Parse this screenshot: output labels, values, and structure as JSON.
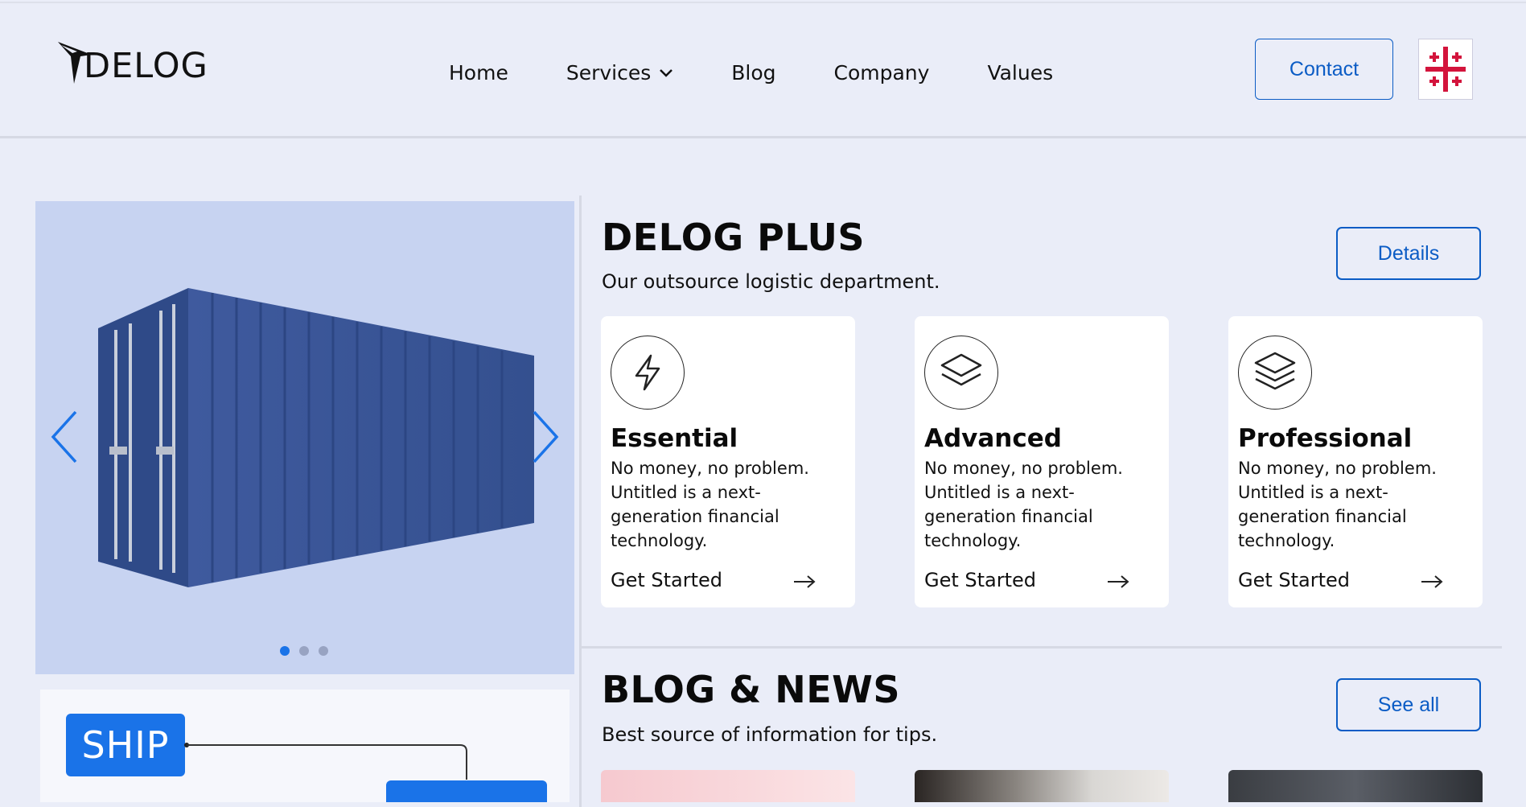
{
  "header": {
    "logo_text": "DELOG",
    "nav": [
      {
        "label": "Home"
      },
      {
        "label": "Services"
      },
      {
        "label": "Blog"
      },
      {
        "label": "Company"
      },
      {
        "label": "Values"
      }
    ],
    "contact_label": "Contact",
    "language_flag": "georgia-flag-icon"
  },
  "hero": {
    "slides_count": 3,
    "active_slide": 1,
    "prev_icon": "chevron-left-icon",
    "next_icon": "chevron-right-icon",
    "diagram_label": "SHIP"
  },
  "plus": {
    "title": "DELOG PLUS",
    "subtitle": "Our outsource logistic department.",
    "details_label": "Details",
    "cards": [
      {
        "icon": "lightning-icon",
        "title": "Essential",
        "description": "No money, no problem. Untitled is a next-generation financial technology.",
        "link": "Get Started"
      },
      {
        "icon": "layers-icon",
        "title": "Advanced",
        "description": "No money, no problem. Untitled is a next-generation financial technology.",
        "link": "Get Started"
      },
      {
        "icon": "stack-icon",
        "title": "Professional",
        "description": "No money, no problem. Untitled is a next-generation financial technology.",
        "link": "Get Started"
      }
    ]
  },
  "blog": {
    "title": "BLOG & NEWS",
    "subtitle": "Best source of information for tips.",
    "see_all_label": "See all"
  },
  "colors": {
    "accent": "#0b5cc5",
    "bright_blue": "#1a73e8",
    "background": "#eaedf8",
    "hero_bg": "#c7d3f1",
    "container_blue": "#3b5597"
  }
}
